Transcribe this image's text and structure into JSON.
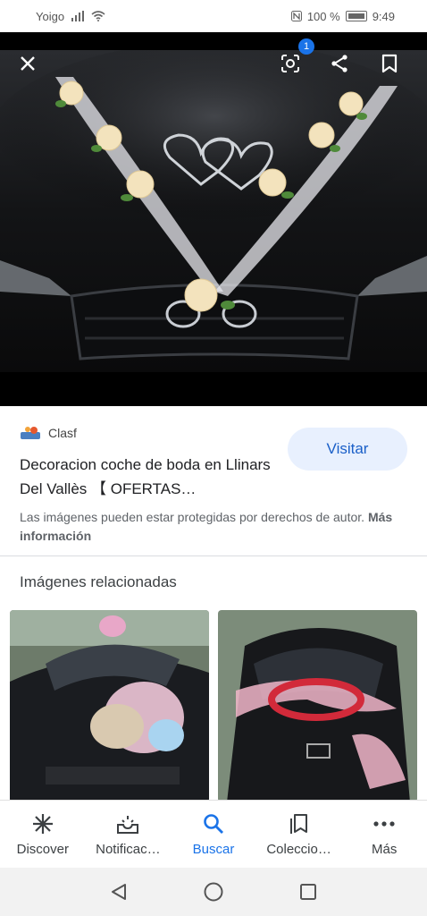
{
  "status_bar": {
    "carrier": "Yoigo",
    "battery": "100 %",
    "time": "9:49"
  },
  "viewer": {
    "lens_badge": "1",
    "close_icon": "close-icon",
    "lens_icon": "google-lens-icon",
    "share_icon": "share-icon",
    "bookmark_icon": "bookmark-icon"
  },
  "result": {
    "source": "Clasf",
    "title": "Decoracion coche de boda en Llinars Del Vallès 【 OFERTAS…",
    "visit_label": "Visitar",
    "copyright_text": "Las imágenes pueden estar protegidas por derechos de autor.",
    "more_info": "Más información"
  },
  "related": {
    "heading": "Imágenes relacionadas"
  },
  "bottom_nav": {
    "items": [
      {
        "label": "Discover",
        "icon": "asterisk-icon"
      },
      {
        "label": "Notificac…",
        "icon": "notifications-icon"
      },
      {
        "label": "Buscar",
        "icon": "search-icon"
      },
      {
        "label": "Coleccio…",
        "icon": "collections-icon"
      },
      {
        "label": "Más",
        "icon": "more-icon"
      }
    ],
    "active_color": "#1a73e8"
  },
  "system_nav": {
    "icons": [
      "back-icon",
      "home-icon",
      "recents-icon"
    ]
  }
}
